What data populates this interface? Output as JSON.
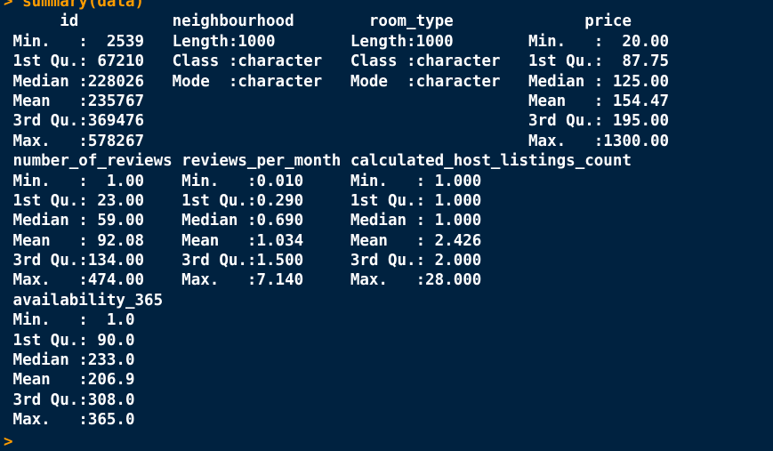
{
  "console": {
    "prompt_symbol": ">",
    "command": "summary(data)",
    "output_lines": [
      "      id          neighbourhood        room_type              price        ",
      " Min.   :  2539   Length:1000        Length:1000        Min.   :  20.00  ",
      " 1st Qu.: 67210   Class :character   Class :character   1st Qu.:  87.75  ",
      " Median :228026   Mode  :character   Mode  :character   Median : 125.00  ",
      " Mean   :235767                                         Mean   : 154.47  ",
      " 3rd Qu.:369476                                         3rd Qu.: 195.00  ",
      " Max.   :578267                                         Max.   :1300.00  ",
      " number_of_reviews reviews_per_month calculated_host_listings_count",
      " Min.   :  1.00    Min.   :0.010     Min.   : 1.000                ",
      " 1st Qu.: 23.00    1st Qu.:0.290     1st Qu.: 1.000                ",
      " Median : 59.00    Median :0.690     Median : 1.000                ",
      " Mean   : 92.08    Mean   :1.034     Mean   : 2.426                ",
      " 3rd Qu.:134.00    3rd Qu.:1.500     3rd Qu.: 2.000                ",
      " Max.   :474.00    Max.   :7.140     Max.   :28.000                ",
      " availability_365",
      " Min.   :  1.0   ",
      " 1st Qu.: 90.0   ",
      " Median :233.0   ",
      " Mean   :206.9   ",
      " 3rd Qu.:308.0   ",
      " Max.   :365.0   "
    ],
    "next_prompt": ">"
  },
  "colors": {
    "background": "#002240",
    "output_text": "#ffffff",
    "prompt": "#ff9d00"
  }
}
